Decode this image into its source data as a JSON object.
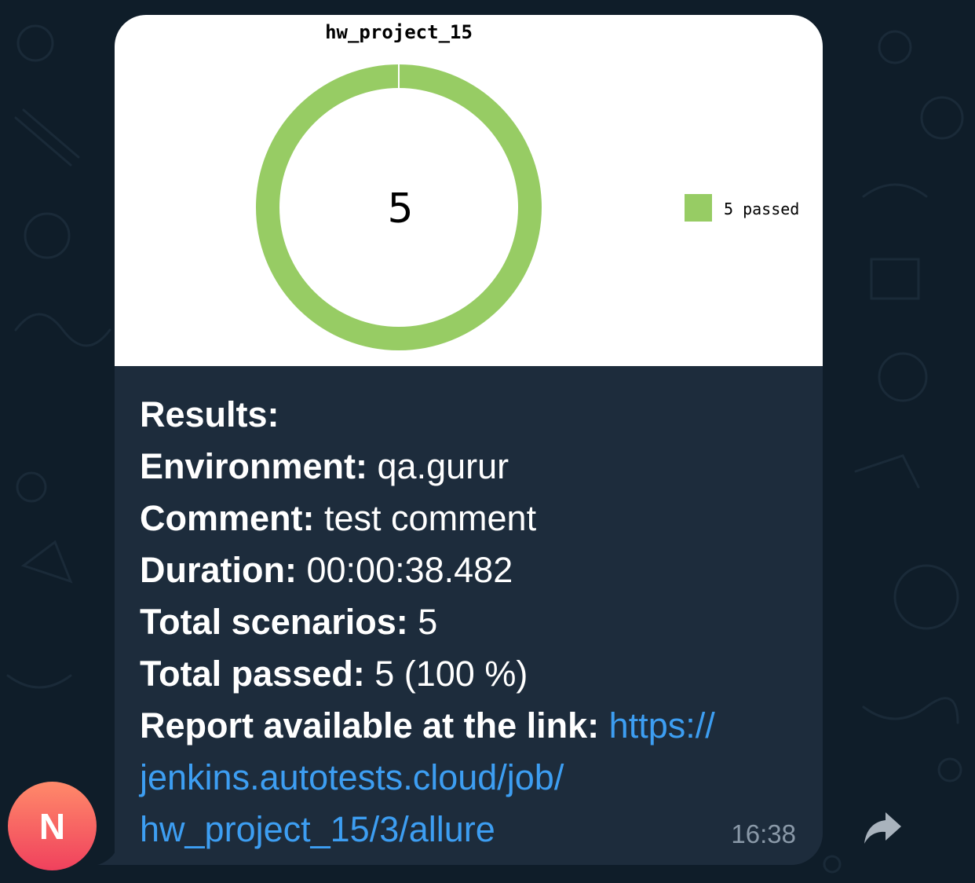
{
  "chart_data": {
    "type": "pie",
    "title": "hw_project_15",
    "center_label": "5",
    "categories": [
      "5 passed"
    ],
    "values": [
      5
    ],
    "colors": [
      "#97cc64"
    ],
    "legend_position": "right"
  },
  "message": {
    "lines": [
      {
        "key": "Results:",
        "value": ""
      },
      {
        "key": "Environment:",
        "value": " qa.gurur"
      },
      {
        "key": "Comment:",
        "value": " test comment"
      },
      {
        "key": "Duration:",
        "value": " 00:00:38.482"
      },
      {
        "key": "Total scenarios:",
        "value": " 5"
      },
      {
        "key": "Total passed:",
        "value": " 5 (100 %)"
      }
    ],
    "report_label": "Report available at the link:",
    "link_parts": [
      "https://",
      "jenkins.autotests.cloud/job/",
      "hw_project_15/3/allure"
    ],
    "time": "16:38"
  },
  "sender": {
    "avatar_initial": "N",
    "avatar_colors": [
      "#ff8a6a",
      "#f0415d"
    ]
  },
  "colors": {
    "background": "#0f1d29",
    "bubble": "#1d2c3c",
    "link": "#3d9ef2",
    "time": "#8a99a8"
  },
  "icons": {
    "forward": "forward-arrow-icon"
  }
}
